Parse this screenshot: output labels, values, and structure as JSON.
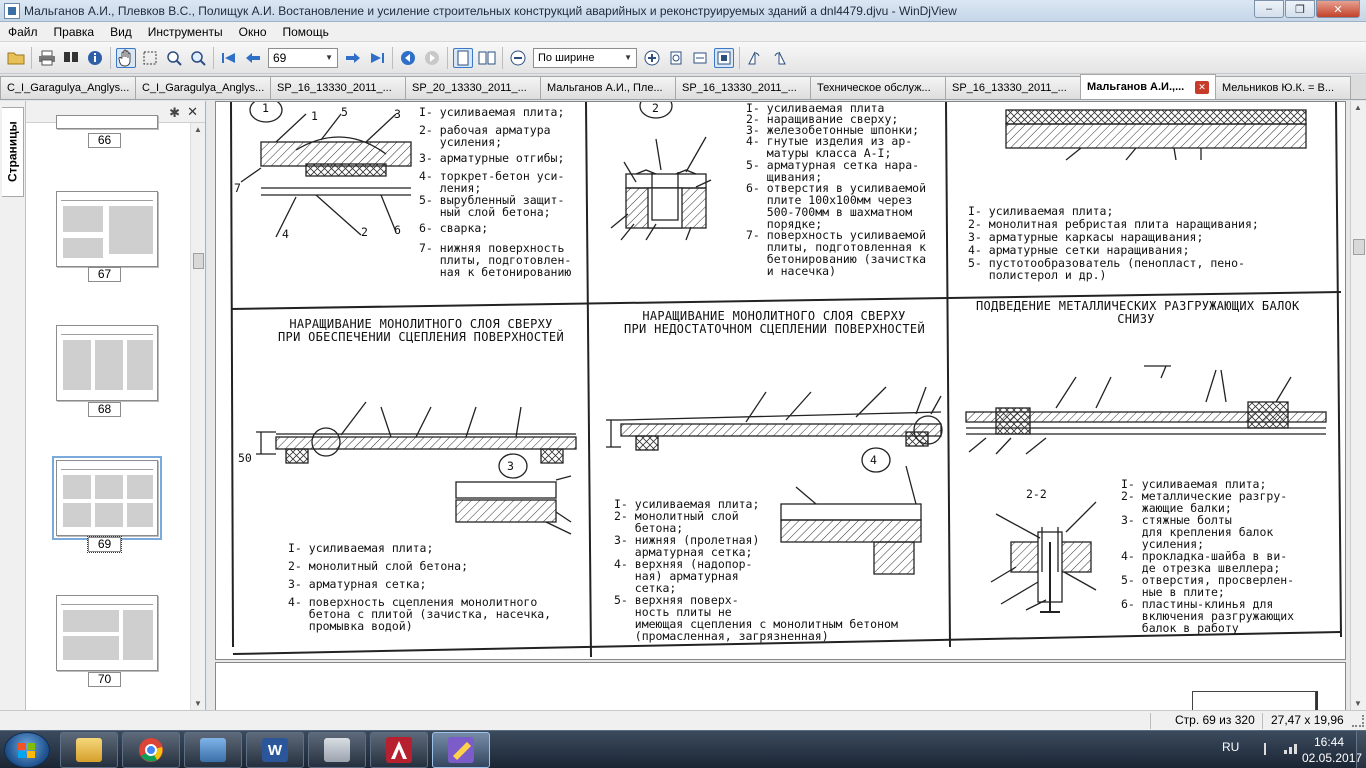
{
  "window": {
    "title": "Мальганов А.И., Плевков В.С., Полищук А.И. Востановление и усиление строительных конструкций аварийных и реконструируемых зданий а dnl4479.djvu - WinDjView",
    "minimize": "–",
    "maximize": "❐",
    "close": "✕"
  },
  "menu": [
    "Файл",
    "Правка",
    "Вид",
    "Инструменты",
    "Окно",
    "Помощь"
  ],
  "toolbar": {
    "page_value": "69",
    "zoom_value": "По ширине"
  },
  "tabs": [
    {
      "label": "C_I_Garagulya_Anglys...",
      "active": false
    },
    {
      "label": "C_I_Garagulya_Anglys...",
      "active": false
    },
    {
      "label": "SP_16_13330_2011_...",
      "active": false
    },
    {
      "label": "SP_20_13330_2011_...",
      "active": false
    },
    {
      "label": "Мальганов А.И., Пле...",
      "active": false
    },
    {
      "label": "SP_16_13330_2011_...",
      "active": false
    },
    {
      "label": "Техническое обслуж...",
      "active": false
    },
    {
      "label": "SP_16_13330_2011_...",
      "active": false
    },
    {
      "label": "Мальганов А.И.,...",
      "active": true
    },
    {
      "label": "Мельников Ю.К. = В...",
      "active": false
    }
  ],
  "sidebar": {
    "tab_label": "Страницы",
    "gear": "✱",
    "close": "✕",
    "thumbnails": [
      {
        "num": "66"
      },
      {
        "num": "67"
      },
      {
        "num": "68"
      },
      {
        "num": "69",
        "selected": true
      },
      {
        "num": "70"
      }
    ]
  },
  "drawing": {
    "top_left": {
      "items": [
        "I- усиливаемая плита;",
        "2- рабочая арматура\n   усиления;",
        "3- арматурные отгибы;",
        "4- торкрет-бетон уси-\n   ления;",
        "5- вырубленный защит-\n   ный слой бетона;",
        "6- сварка;",
        "7- нижняя поверхность\n   плиты, подготовлен-\n   ная к бетонированию"
      ]
    },
    "top_middle": {
      "items": [
        "I- усиливаемая плита",
        "2- наращивание сверху;",
        "3- железобетонные шпонки;",
        "4- гнутые изделия из ар-\n   матуры класса А-I;",
        "5- арматурная сетка нара-\n   щивания;",
        "6- отверстия в усиливаемой\n   плите 100х100мм через\n   500-700мм в шахматном\n   порядке;",
        "7- поверхность усиливаемой\n   плиты, подготовленная к\n   бетонированию (зачистка\n   и насечка)"
      ]
    },
    "top_right": {
      "items": [
        "I- усиливаемая плита;",
        "2- монолитная ребристая плита наращивания;",
        "3- арматурные каркасы наращивания;",
        "4- арматурные сетки наращивания;",
        "5- пустотообразователь (пенопласт, пено-\n   полистерол и др.)"
      ]
    },
    "panel4": {
      "title": "НАРАЩИВАНИЕ МОНОЛИТНОГО СЛОЯ СВЕРХУ\nПРИ ОБЕСПЕЧЕНИИ СЦЕПЛЕНИЯ ПОВЕРХНОСТЕЙ",
      "items": [
        "I- усиливаемая плита;",
        "2- монолитный слой бетона;",
        "3- арматурная сетка;",
        "4- поверхность сцепления монолитного\n   бетона с плитой (зачистка, насечка,\n   промывка водой)"
      ]
    },
    "panel5": {
      "title": "НАРАЩИВАНИЕ МОНОЛИТНОГО СЛОЯ СВЕРХУ\nПРИ НЕДОСТАТОЧНОМ СЦЕПЛЕНИИ ПОВЕРХНОСТЕЙ",
      "items": [
        "I- усиливаемая плита;",
        "2- монолитный слой\n   бетона;",
        "3- нижняя (пролетная)\n   арматурная сетка;",
        "4- верхняя (надопор-\n   ная) арматурная\n   сетка;",
        "5- верхняя поверх-\n   ность плиты не\n   имеющая сцепления с монолитным бетоном\n   (промасленная, загрязненная)"
      ]
    },
    "panel6": {
      "title": "ПОДВЕДЕНИЕ МЕТАЛЛИЧЕСКИХ РАЗГРУЖАЮЩИХ БАЛОК\nСНИЗУ",
      "section": "2-2",
      "items": [
        "I- усиливаемая плита;",
        "2- металлические разгру-\n   жающие балки;",
        "3- стяжные болты\n   для крепления балок\n   усиления;",
        "4- прокладка-шайба в ви-\n   де отрезка швеллера;",
        "5- отверстия, просверлен-\n   ные в плите;",
        "6- пластины-клинья для\n   включения разгружающих\n   балок в работу"
      ]
    },
    "callouts": {
      "c1": "1",
      "c2": "2",
      "c3": "3",
      "c4": "4",
      "c5": "5",
      "c6": "6",
      "c7": "7",
      "d50": "50",
      "circ1": "1",
      "circ2": "2",
      "circ3": "3",
      "circ4": "4"
    }
  },
  "status": {
    "page": "Стр. 69 из 320",
    "size": "27,47 x 19,96 см"
  },
  "taskbar": {
    "lang": "RU",
    "time": "16:44",
    "date": "02.05.2017"
  }
}
